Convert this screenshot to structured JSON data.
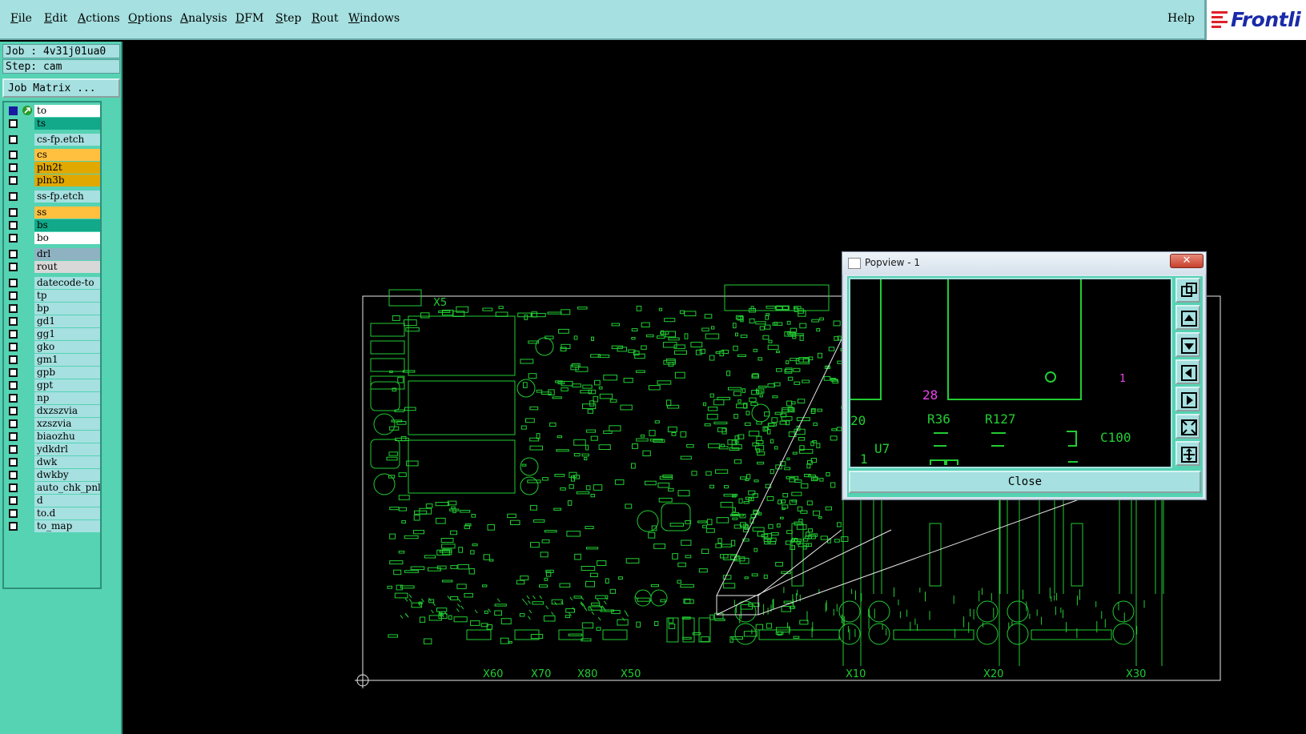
{
  "menubar": {
    "items": [
      {
        "label": "File",
        "ul": "F",
        "rest": "ile"
      },
      {
        "label": "Edit",
        "ul": "E",
        "rest": "dit"
      },
      {
        "label": "Actions",
        "ul": "A",
        "rest": "ctions"
      },
      {
        "label": "Options",
        "ul": "O",
        "rest": "ptions"
      },
      {
        "label": "Analysis",
        "ul": "A",
        "rest": "nalysis"
      },
      {
        "label": "DFM",
        "ul": "D",
        "rest": "FM"
      },
      {
        "label": "Step",
        "ul": "S",
        "rest": "tep"
      },
      {
        "label": "Rout",
        "ul": "R",
        "rest": "out"
      },
      {
        "label": "Windows",
        "ul": "W",
        "rest": "indows"
      }
    ],
    "help": "Help",
    "logo": "Frontli"
  },
  "job": {
    "job_label": "Job : 4v31j01ua0",
    "step_label": "Step: cam",
    "matrix_button": "Job Matrix ..."
  },
  "layers": [
    {
      "name": "to",
      "color": "#ffffff",
      "active": true
    },
    {
      "name": "ts",
      "color": "#12a98a"
    },
    {
      "name": "cs-fp.etch",
      "color": "#a6e0e0"
    },
    {
      "name": "cs",
      "color": "#ffc040"
    },
    {
      "name": "pln2t",
      "color": "#e0a800"
    },
    {
      "name": "pln3b",
      "color": "#e0a800"
    },
    {
      "name": "ss-fp.etch",
      "color": "#a6e0e0"
    },
    {
      "name": "ss",
      "color": "#ffc040"
    },
    {
      "name": "bs",
      "color": "#12a98a"
    },
    {
      "name": "bo",
      "color": "#ffffff"
    },
    {
      "name": "drl",
      "color": "#8fb2c2"
    },
    {
      "name": "rout",
      "color": "#d8d8d8"
    },
    {
      "name": "datecode-to",
      "color": "#a6e0e0"
    },
    {
      "name": "tp",
      "color": "#a6e0e0"
    },
    {
      "name": "bp",
      "color": "#a6e0e0"
    },
    {
      "name": "gd1",
      "color": "#a6e0e0"
    },
    {
      "name": "gg1",
      "color": "#a6e0e0"
    },
    {
      "name": "gko",
      "color": "#a6e0e0"
    },
    {
      "name": "gm1",
      "color": "#a6e0e0"
    },
    {
      "name": "gpb",
      "color": "#a6e0e0"
    },
    {
      "name": "gpt",
      "color": "#a6e0e0"
    },
    {
      "name": "np",
      "color": "#a6e0e0"
    },
    {
      "name": "dxzszvia",
      "color": "#a6e0e0"
    },
    {
      "name": "xzszvia",
      "color": "#a6e0e0"
    },
    {
      "name": "biaozhu",
      "color": "#a6e0e0"
    },
    {
      "name": "ydkdrl",
      "color": "#a6e0e0"
    },
    {
      "name": "dwk",
      "color": "#a6e0e0"
    },
    {
      "name": "dwkby",
      "color": "#a6e0e0"
    },
    {
      "name": "auto_chk_pnl",
      "color": "#a6e0e0"
    },
    {
      "name": "d",
      "color": "#a6e0e0"
    },
    {
      "name": "to.d",
      "color": "#a6e0e0"
    },
    {
      "name": "to_map",
      "color": "#a6e0e0"
    }
  ],
  "pcb": {
    "labels": [
      "X5",
      "X60",
      "X70",
      "X80",
      "X50",
      "X10",
      "X20",
      "X30"
    ],
    "trace_color": "#22cc33"
  },
  "popview": {
    "title": "Popview - 1",
    "close_x": "✕",
    "close_button": "Close",
    "view_labels": {
      "n28": "28",
      "r36": "R36",
      "r127": "R127",
      "u7": "U7",
      "c100": "C100",
      "n20": "20",
      "n1": "1",
      "n1m": "1"
    },
    "tools": [
      "zoom-fit-icon",
      "pan-up-icon",
      "pan-down-icon",
      "pan-left-icon",
      "pan-right-icon",
      "zoom-out-icon",
      "zoom-in-icon"
    ]
  }
}
